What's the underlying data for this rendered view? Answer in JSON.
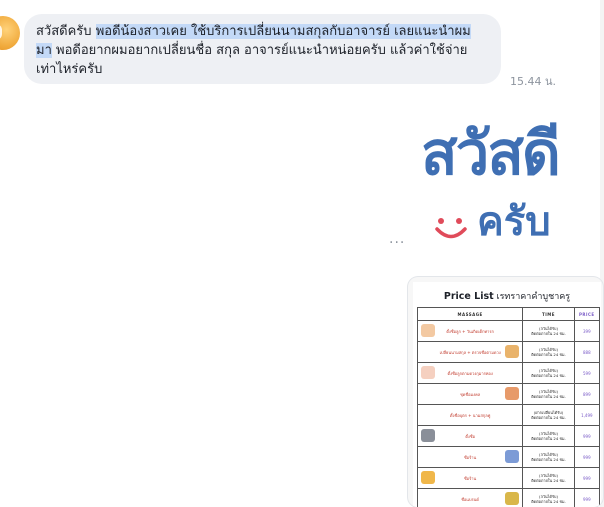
{
  "chat": {
    "message_before": "สวัสดีครับ ",
    "message_highlight": "พอดีน้องสาวเคย ใช้บริการเปลี่ยนนามสกุลกับอาจารย์ เลยแนะนำผม\nมา",
    "message_after": " พอดีอยากผมอยากเปลี่ยนชื่อ สกุล อาจารย์แนะนำหน่อยครับ แล้วค่าใช้จ่าย\nเท่าไหร่ครับ",
    "timestamp": "15.44 น.",
    "sticker_top": "สวัสดี",
    "sticker_bottom": "ครับ",
    "more_label": "···"
  },
  "price_list": {
    "title": "Price List",
    "subtitle": " เรทราคาคำบูชาครู",
    "columns": [
      "MASSAGE",
      "TIME",
      "PRICE"
    ],
    "rows": [
      {
        "service": "ตั้งชื่อลูก + วันเกิดเด็กทารก",
        "time": "(3วันได้รับ)\nติดต่อภายใน 24 ชม.",
        "price": "399",
        "art": "left",
        "color": "#f3c9a2"
      },
      {
        "service": "เปลี่ยนนามสกุล + ตรวจชื่อตามดวง",
        "time": "(3วันได้รับ)\nติดต่อภายใน 24 ชม.",
        "price": "888",
        "art": "right",
        "color": "#e9b36b"
      },
      {
        "service": "ตั้งชื่อลูกตามดวงกุมารทอง",
        "time": "(3วันได้รับ)\nติดต่อภายใน 24 ชม.",
        "price": "599",
        "art": "left",
        "color": "#f5d0c0"
      },
      {
        "service": "ชุดชื่อมงคล",
        "time": "(3วันได้รับ)\nติดต่อภายใน 24 ชม.",
        "price": "899",
        "art": "right",
        "color": "#e79a6a"
      },
      {
        "service": "ตั้งชื่อบุตร + นามสกุลคู่",
        "time": "(ฝากเปลี่ยนได้รับ)\nติดต่อภายใน 24 ชม.",
        "price": "1,499",
        "art": "none",
        "color": "#ffffff"
      },
      {
        "service": "ตั้งชื่อ",
        "time": "(3วันได้รับ)\nติดต่อภายใน 24 ชม.",
        "price": "999",
        "art": "left",
        "color": "#8a8f99"
      },
      {
        "service": "ชื่อร้าน",
        "time": "(3วันได้รับ)\nติดต่อภายใน 24 ชม.",
        "price": "999",
        "art": "right",
        "color": "#7c9bd6"
      },
      {
        "service": "ชื่อร้าน",
        "time": "(3วันได้รับ)\nติดต่อภายใน 24 ชม.",
        "price": "999",
        "art": "left",
        "color": "#f0b74a"
      },
      {
        "service": "ชื่อแบรนด์",
        "time": "(3วันได้รับ)\nติดต่อภายใน 24 ชม.",
        "price": "999",
        "art": "right",
        "color": "#d9b74a"
      }
    ]
  },
  "colors": {
    "bubble": "#eef0f4",
    "highlight": "#c3d9f7",
    "sticker": "#3f6fb3",
    "smile": "#e04b5a"
  }
}
